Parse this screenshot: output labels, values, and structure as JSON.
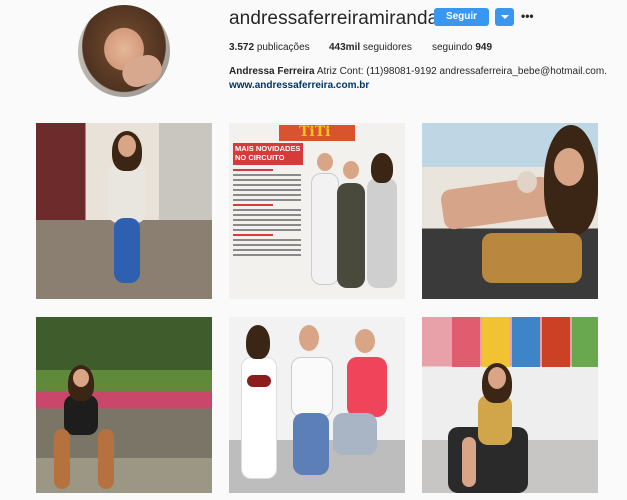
{
  "profile": {
    "username": "andressaferreiramiranda",
    "follow_label": "Seguir",
    "more_label": "•••",
    "stats": {
      "posts_count": "3.572",
      "posts_label": "publicações",
      "followers_count": "443mil",
      "followers_label": "seguidores",
      "following_label": "seguindo",
      "following_count": "949"
    },
    "bio": {
      "full_name": "Andressa Ferreira",
      "text": "Atriz Cont: (11)98081-9192 andressaferreira_bebe@hotmail.com.",
      "link": "www.andressaferreira.com.br"
    }
  },
  "posts": {
    "magazine": {
      "logo": "TiTi",
      "headline": "MAIS NOVIDADES NO CIRCUITO"
    }
  },
  "colors": {
    "accent": "#3897f0",
    "link": "#003569",
    "background": "#fafafa"
  }
}
